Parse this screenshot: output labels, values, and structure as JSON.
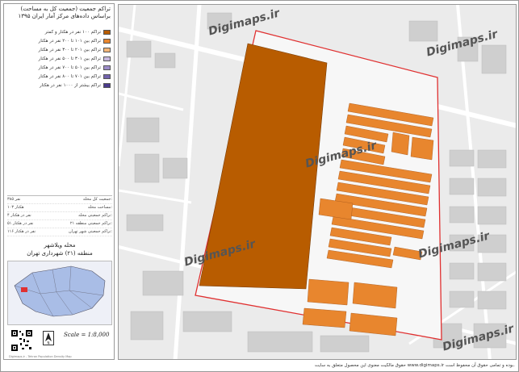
{
  "panel": {
    "title_line1": "تراکم جمعیت (جمعیت کل به مساحت)",
    "title_line2": "براساس داده‌های مرکز آمار ایران ۱۳۹۵"
  },
  "legend": [
    {
      "label": "تراکم ۱۰۰ نفر در هکتار و کمتر",
      "color": "#b85c00"
    },
    {
      "label": "تراکم بین ۱۰۱ تا ۲۰۰ نفر در هکتار",
      "color": "#e8862e"
    },
    {
      "label": "تراکم بین ۲۰۱ تا ۳۰۰ نفر در هکتار",
      "color": "#f4b677"
    },
    {
      "label": "تراکم بین ۳۰۱ تا ۵۰۰ نفر در هکتار",
      "color": "#c8b8e0"
    },
    {
      "label": "تراکم بین ۵۰۱ تا ۷۰۰ نفر در هکتار",
      "color": "#9c8cc8"
    },
    {
      "label": "تراکم بین ۷۰۱ تا ۸۰۰ نفر در هکتار",
      "color": "#7363ad"
    },
    {
      "label": "تراکم بیشتر از ۱۰۰۰ نفر در هکتار",
      "color": "#4b3c8c"
    }
  ],
  "stats": [
    {
      "label": "جمعیت کل محله:",
      "value": "۳۸۵ نفر"
    },
    {
      "label": "مساحت محله:",
      "value": "۱۰۳ هکتار"
    },
    {
      "label": "تراکم جمعیتی محله:",
      "value": "۴ نفر در هکتار"
    },
    {
      "label": "تراکم جمعیتی منطقه ۲۱:",
      "value": "۵۱ نفر در هکتار"
    },
    {
      "label": "تراکم جمعیتی شهر تهران:",
      "value": "۱۱۶ نفر در هکتار"
    }
  ],
  "location": {
    "line1": "محله ویلاشهر",
    "line2": "منطقه (۲۱) شهرداری تهران"
  },
  "scale_text": "Scale = 1:8,000",
  "credit_text": "Digimaps.ir - Tehran Population Density Map",
  "footer_text": "حقوق مالکیت معنوی این محصول متعلق به سایت www.digimaps.ir بوده و تمامی حقوق آن محفوظ است.",
  "watermark": "Digimaps.ir",
  "colors": {
    "primary": "#b85c00",
    "block": "#e8862e",
    "boundary": "#e03030"
  }
}
